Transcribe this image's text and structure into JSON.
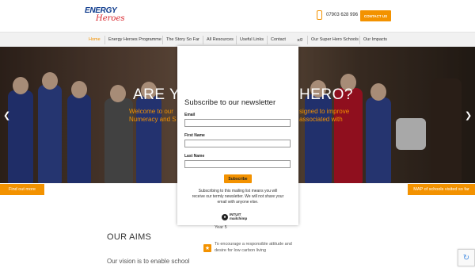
{
  "header": {
    "logo_top": "ENERGY",
    "logo_bottom": "Heroes",
    "phone": "07903 628 996",
    "contact_label": "CONTACT US"
  },
  "nav": {
    "items": [
      {
        "label": "Home"
      },
      {
        "label": "Energy Heroes Programme"
      },
      {
        "label": "The Story So Far"
      },
      {
        "label": "All Resources"
      },
      {
        "label": "Useful Links"
      },
      {
        "label": "Contact"
      },
      {
        "label": "g"
      },
      {
        "label": "Our Super Hero Schools"
      },
      {
        "label": "Our Impacts"
      }
    ]
  },
  "hero": {
    "title_left": "ARE Y",
    "title_right": "HERO?",
    "sub1_left": "Welcome to our",
    "sub1_right": "signed to improve",
    "sub2_left": "Numeracy and S",
    "sub2_right": "associated with",
    "prev_icon": "chevron-left-icon",
    "next_icon": "chevron-right-icon",
    "find_label": "Find out more",
    "map_label": "MAP of schools visited so far"
  },
  "content": {
    "aims_title": "OUR AIMS",
    "vision": "Our vision is to enable school",
    "year5": "Year 5",
    "aim_text": "To encourage a responsible attitude and desire for low carbon living"
  },
  "modal": {
    "title": "Subscribe to our newsletter",
    "email_label": "Email",
    "first_label": "First Name",
    "last_label": "Last Name",
    "button": "Subscribe",
    "disclaimer": "Subscribing to this mailing list means you will receive our termly newsletter. We will not share your email with anyone else.",
    "mc_line1": "INTUIT",
    "mc_line2": "mailchimp",
    "close": "×"
  },
  "colors": {
    "accent": "#f39200",
    "brand_blue": "#0d3a8c",
    "brand_red": "#d8232a"
  }
}
